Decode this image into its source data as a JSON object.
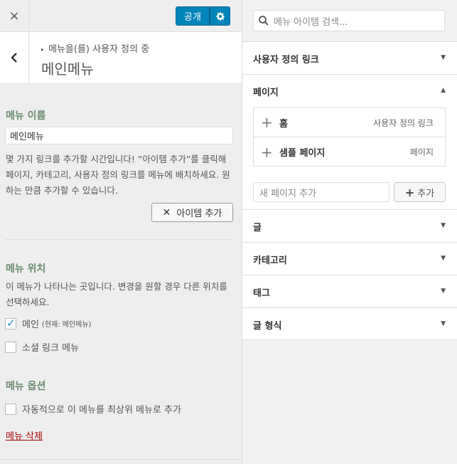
{
  "topbar": {
    "close_icon": "×",
    "publish_label": "공개"
  },
  "header": {
    "breadcrumb": "메뉴을(를) 사용자 정의 중",
    "title": "메인메뉴"
  },
  "menu_name": {
    "label": "메뉴 이름",
    "value": "메인메뉴",
    "description": "몇 가지 링크를 추가할 시간입니다! “아이템 추가”를 클릭해 페이지, 카테고리, 사용자 정의 링크를 메뉴에 배치하세요. 원하는 만큼 추가할 수 있습니다.",
    "add_items_label": "아이템 추가"
  },
  "menu_locations": {
    "label": "메뉴 위치",
    "description": "이 메뉴가 나타나는 곳입니다. 변경을 원할 경우 다른 위치를 선택하세요.",
    "items": [
      {
        "label": "메인",
        "note": "(현재: 메인메뉴)",
        "checked": true
      },
      {
        "label": "소셜 링크 메뉴",
        "note": "",
        "checked": false
      }
    ]
  },
  "menu_options": {
    "label": "메뉴 옵션",
    "auto_add_label": "자동적으로 이 메뉴를 최상위 메뉴로 추가"
  },
  "delete_label": "메뉴 삭제",
  "right": {
    "search_placeholder": "메뉴 아이템 검색...",
    "sections": {
      "custom_links": "사용자 정의 링크",
      "pages": "페이지",
      "posts": "글",
      "categories": "카테고리",
      "tags": "태그",
      "post_formats": "글 형식"
    },
    "pages_list": [
      {
        "title": "홈",
        "type": "사용자 정의 링크"
      },
      {
        "title": "샘플 페이지",
        "type": "페이지"
      }
    ],
    "new_page_placeholder": "새 페이지 추가",
    "add_label": "추가"
  },
  "colors": {
    "accent": "#0085ba",
    "label_green": "#6a8b6f",
    "delete_red": "#aa0000"
  }
}
